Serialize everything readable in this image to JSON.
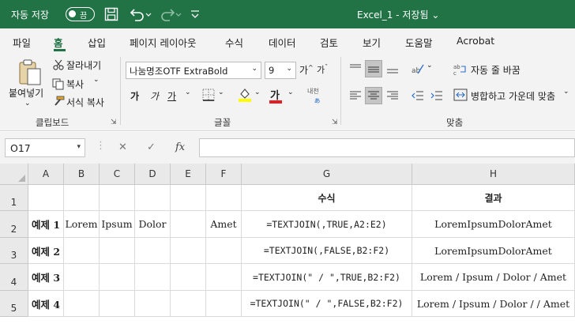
{
  "titlebar": {
    "autosave_label": "자동 저장",
    "autosave_state": "끔",
    "document_title": "Excel_1 - 저장됨 ⌄"
  },
  "tabs": [
    {
      "label": "파일"
    },
    {
      "label": "홈"
    },
    {
      "label": "삽입"
    },
    {
      "label": "페이지 레이아웃"
    },
    {
      "label": "수식"
    },
    {
      "label": "데이터"
    },
    {
      "label": "검토"
    },
    {
      "label": "보기"
    },
    {
      "label": "도움말"
    },
    {
      "label": "Acrobat"
    }
  ],
  "ribbon": {
    "clipboard": {
      "paste": "붙여넣기",
      "cut": "잘라내기",
      "copy": "복사",
      "format_painter": "서식 복사",
      "group": "클립보드"
    },
    "font": {
      "font_name": "나눔명조OTF ExtraBold",
      "font_size": "9",
      "bold": "가",
      "italic": "가",
      "underline": "가",
      "font_color_glyph": "가",
      "phonetic": "내천",
      "group": "글꼴"
    },
    "alignment": {
      "wrap_text": "자동 줄 바꿈",
      "merge_center": "병합하고 가운데 맞춤",
      "group": "맞춤"
    }
  },
  "formula_bar": {
    "name_box": "O17",
    "cancel": "✕",
    "enter": "✓",
    "fx": "fx",
    "formula": ""
  },
  "columns": [
    "A",
    "B",
    "C",
    "D",
    "E",
    "F",
    "G",
    "H"
  ],
  "rows": [
    {
      "num": "1",
      "cells": [
        "",
        "",
        "",
        "",
        "",
        "",
        "수식",
        "결과"
      ]
    },
    {
      "num": "2",
      "cells": [
        "예제 1",
        "Lorem",
        "Ipsum",
        "Dolor",
        "",
        "Amet",
        "=TEXTJOIN(,TRUE,A2:E2)",
        "LoremIpsumDolorAmet"
      ]
    },
    {
      "num": "3",
      "cells": [
        "예제 2",
        "",
        "",
        "",
        "",
        "",
        "=TEXTJOIN(,FALSE,B2:F2)",
        "LoremIpsumDolorAmet"
      ]
    },
    {
      "num": "4",
      "cells": [
        "예제 3",
        "",
        "",
        "",
        "",
        "",
        "=TEXTJOIN(\" / \",TRUE,B2:F2)",
        "Lorem / Ipsum / Dolor / Amet"
      ]
    },
    {
      "num": "5",
      "cells": [
        "예제 4",
        "",
        "",
        "",
        "",
        "",
        "=TEXTJOIN(\" / \",FALSE,B2:F2)",
        "Lorem / Ipsum / Dolor /  / Amet"
      ]
    }
  ],
  "colors": {
    "accent": "#217346",
    "font_color": "#e51c23",
    "highlight": "#ffff00"
  }
}
